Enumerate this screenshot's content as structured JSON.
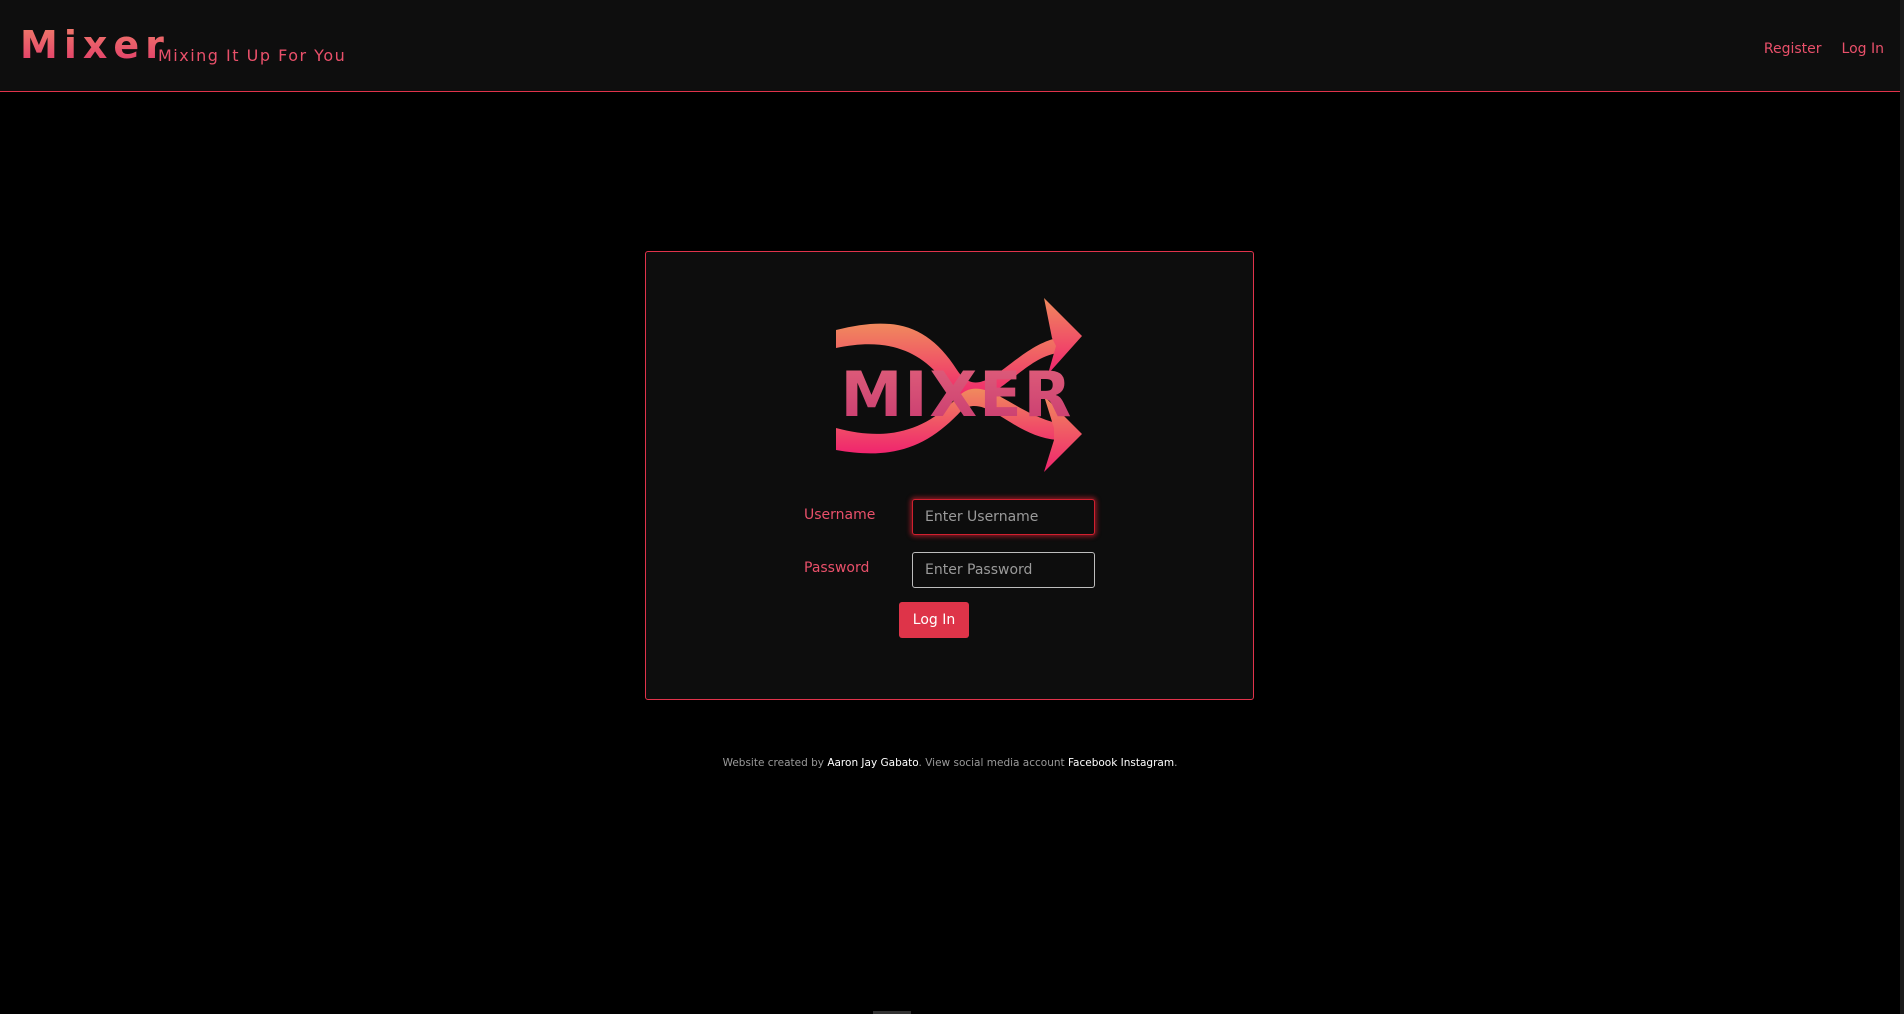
{
  "header": {
    "brand": "Mixer",
    "tagline": "Mixing It Up For You",
    "nav": [
      {
        "label": "Register"
      },
      {
        "label": "Log In"
      }
    ]
  },
  "login_form": {
    "logo_text": "MIXER",
    "username_label": "Username",
    "username_placeholder": "Enter Username",
    "username_value": "",
    "password_label": "Password",
    "password_placeholder": "Enter Password",
    "password_value": "",
    "submit_label": "Log In"
  },
  "footer": {
    "prefix": "Website created by ",
    "author": "Aaron Jay Gabato",
    "middle": ". View social media account ",
    "facebook": "Facebook",
    "instagram": "Instagram",
    "suffix": "."
  },
  "colors": {
    "accent": "#e9506a",
    "button": "#de3449",
    "border": "#e0334b",
    "background": "#000000",
    "panel": "#0d0d0d"
  }
}
